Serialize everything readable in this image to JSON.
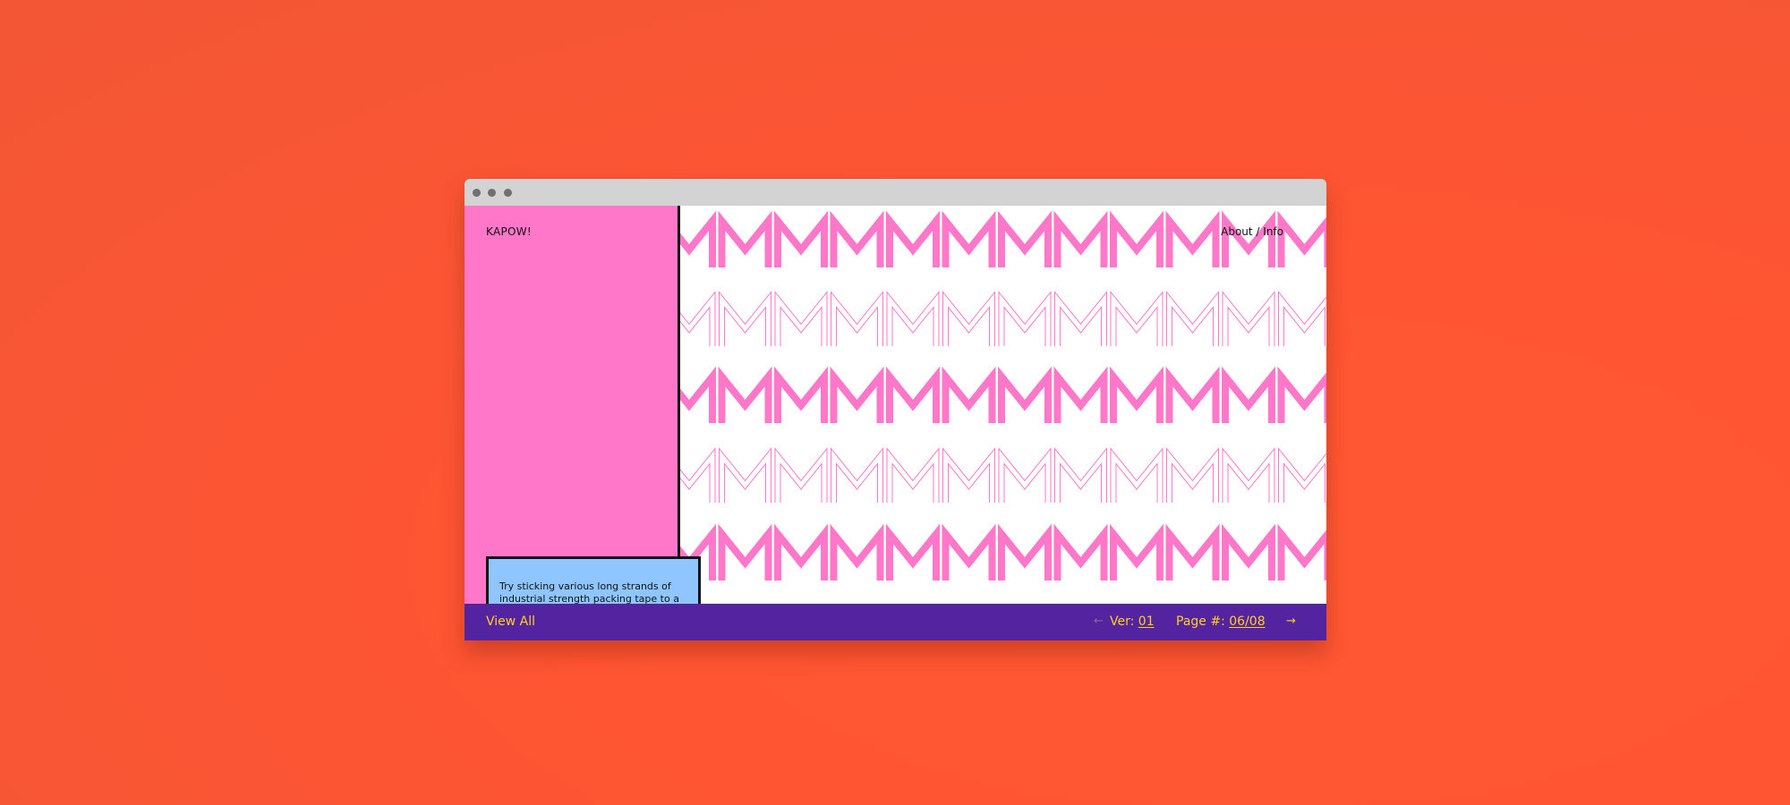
{
  "window": {
    "titlebar_dots": 3
  },
  "header": {
    "brand": "KAPOW!",
    "nav_link": "About / Info"
  },
  "pattern": {
    "glyph": "M",
    "fill_color": "#ff77c8",
    "outline_color": "#ff77c8"
  },
  "card": {
    "text": "Try sticking various long strands of industrial strength packing tape to a firmly mounted window, and experiment with pulling it off in a way that causes a krk-krk-krk-krk stuttering effect.",
    "icon": "info-icon"
  },
  "footer": {
    "view_all": "View All",
    "ver_label": "Ver:",
    "ver_value": "01",
    "page_label": "Page #:",
    "page_value": "06/08",
    "prev_icon": "arrow-left-icon",
    "next_icon": "arrow-right-icon"
  },
  "colors": {
    "background": "#ff5733",
    "sidebar": "#ff77c8",
    "card": "#8fc6ff",
    "footer": "#5423a0",
    "footer_text": "#ffd21a"
  }
}
